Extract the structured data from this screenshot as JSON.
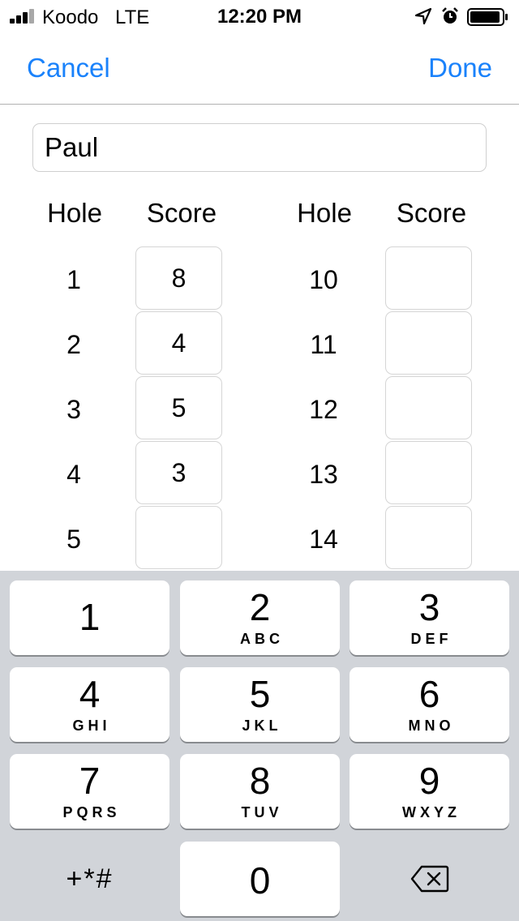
{
  "status_bar": {
    "carrier": "Koodo",
    "network": "LTE",
    "time": "12:20 PM",
    "icons": [
      "signal-icon",
      "location-arrow-icon",
      "alarm-clock-icon",
      "battery-icon"
    ]
  },
  "nav": {
    "cancel_label": "Cancel",
    "done_label": "Done",
    "accent_color": "#1a82fb"
  },
  "player": {
    "name": "Paul"
  },
  "table": {
    "left": {
      "hole_header": "Hole",
      "score_header": "Score",
      "rows": [
        {
          "hole": "1",
          "score": "8"
        },
        {
          "hole": "2",
          "score": "4"
        },
        {
          "hole": "3",
          "score": "5"
        },
        {
          "hole": "4",
          "score": "3"
        },
        {
          "hole": "5",
          "score": ""
        }
      ]
    },
    "right": {
      "hole_header": "Hole",
      "score_header": "Score",
      "rows": [
        {
          "hole": "10",
          "score": ""
        },
        {
          "hole": "11",
          "score": ""
        },
        {
          "hole": "12",
          "score": ""
        },
        {
          "hole": "13",
          "score": ""
        },
        {
          "hole": "14",
          "score": ""
        }
      ]
    }
  },
  "keypad": {
    "keys": [
      {
        "digit": "1",
        "letters": ""
      },
      {
        "digit": "2",
        "letters": "ABC"
      },
      {
        "digit": "3",
        "letters": "DEF"
      },
      {
        "digit": "4",
        "letters": "GHI"
      },
      {
        "digit": "5",
        "letters": "JKL"
      },
      {
        "digit": "6",
        "letters": "MNO"
      },
      {
        "digit": "7",
        "letters": "PQRS"
      },
      {
        "digit": "8",
        "letters": "TUV"
      },
      {
        "digit": "9",
        "letters": "WXYZ"
      }
    ],
    "symbols_label": "+*#",
    "zero": "0",
    "delete_icon": "delete-backspace-icon"
  }
}
